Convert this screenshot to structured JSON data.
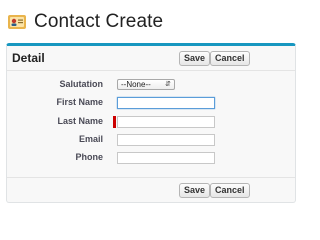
{
  "page": {
    "title": "Contact Create",
    "icon": "contact-card-icon"
  },
  "panel": {
    "title": "Detail",
    "buttons": {
      "save": "Save",
      "cancel": "Cancel"
    }
  },
  "form": {
    "salutation": {
      "label": "Salutation",
      "value": "--None--"
    },
    "first_name": {
      "label": "First Name",
      "value": ""
    },
    "last_name": {
      "label": "Last Name",
      "value": "",
      "required": true
    },
    "email": {
      "label": "Email",
      "value": ""
    },
    "phone": {
      "label": "Phone",
      "value": ""
    }
  },
  "colors": {
    "accent": "#1797c0",
    "required": "#cc0000",
    "focus": "#5b9dd9"
  }
}
